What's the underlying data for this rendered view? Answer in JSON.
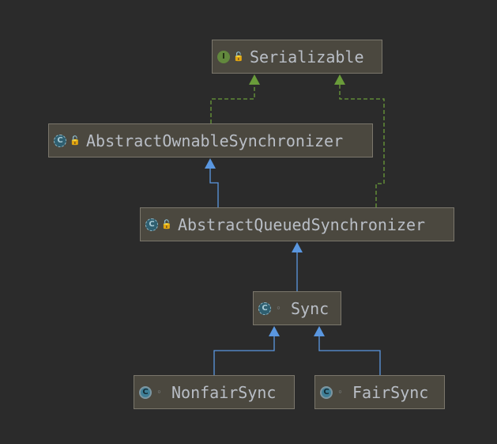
{
  "diagram": {
    "colors": {
      "background": "#2b2b2b",
      "node_fill": "#4b483f",
      "node_border": "#7b776c",
      "text": "#b9bec6",
      "extends_edge": "#5a97e0",
      "implements_edge": "#6a9c3a"
    },
    "nodes": [
      {
        "id": "serializable",
        "label": "Serializable",
        "kind": "interface",
        "icon_letter": "I",
        "visibility": "public"
      },
      {
        "id": "aos",
        "label": "AbstractOwnableSynchronizer",
        "kind": "abstract-class",
        "icon_letter": "C",
        "visibility": "public"
      },
      {
        "id": "aqs",
        "label": "AbstractQueuedSynchronizer",
        "kind": "abstract-class",
        "icon_letter": "C",
        "visibility": "public"
      },
      {
        "id": "sync",
        "label": "Sync",
        "kind": "abstract-static-class",
        "icon_letter": "C",
        "visibility": "package-private"
      },
      {
        "id": "nonfair",
        "label": "NonfairSync",
        "kind": "static-class",
        "icon_letter": "C",
        "visibility": "package-private"
      },
      {
        "id": "fair",
        "label": "FairSync",
        "kind": "static-class",
        "icon_letter": "C",
        "visibility": "package-private"
      }
    ],
    "edges": [
      {
        "from": "aos",
        "to": "serializable",
        "type": "implements"
      },
      {
        "from": "aqs",
        "to": "serializable",
        "type": "implements"
      },
      {
        "from": "aqs",
        "to": "aos",
        "type": "extends"
      },
      {
        "from": "sync",
        "to": "aqs",
        "type": "extends"
      },
      {
        "from": "nonfair",
        "to": "sync",
        "type": "extends"
      },
      {
        "from": "fair",
        "to": "sync",
        "type": "extends"
      }
    ]
  }
}
